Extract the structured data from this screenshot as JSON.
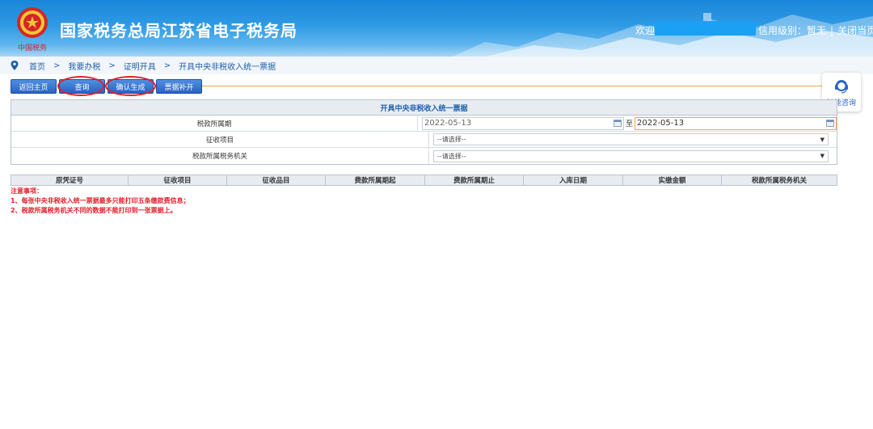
{
  "header": {
    "site_title": "国家税务总局江苏省电子税务局",
    "welcome": "欢迎",
    "credit_label": "信用级别：暂无",
    "separator": "|",
    "close_label": "关闭当页",
    "emblem_caption": "中国税务",
    "colors": {
      "banner": "#2f9ae4",
      "text": "#ffffff"
    }
  },
  "breadcrumb": {
    "items": [
      "首页",
      "我要办税",
      "证明开具",
      "开具中央非税收入统一票据"
    ],
    "arrow": ">"
  },
  "toolbar": {
    "buttons": [
      "返回主页",
      "查询",
      "确认生成",
      "票据补开"
    ]
  },
  "consult": {
    "label": "智能咨询"
  },
  "form": {
    "title": "开具中央非税收入统一票据",
    "rows": {
      "period": {
        "label": "税款所属期",
        "start": "2022-05-13",
        "to": "至",
        "end": "2022-05-13"
      },
      "levy_item": {
        "label": "征收项目",
        "value": "--请选择--"
      },
      "tax_authority": {
        "label": "税款所属税务机关",
        "value": "--请选择--"
      }
    }
  },
  "result_table": {
    "columns": [
      "原凭证号",
      "征收项目",
      "征收品目",
      "费款所属期起",
      "费款所属期止",
      "入库日期",
      "实缴金额",
      "税款所属税务机关"
    ]
  },
  "notes": {
    "title": "注意事项：",
    "items": [
      "1、每张中央非税收入统一票据最多只能打印五条缴款费信息；",
      "2、税款所属税务机关不同的数据不能打印到一张票据上。"
    ]
  },
  "accent_colors": {
    "button": "#2a63c3",
    "annotation": "#e0202a",
    "divider": "#f2a63a"
  }
}
